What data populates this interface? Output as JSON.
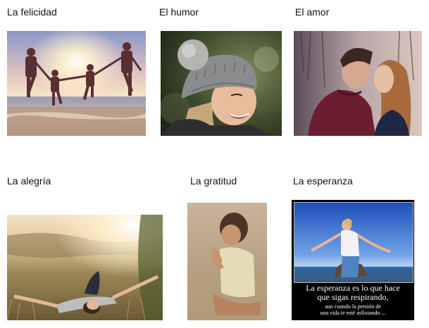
{
  "labels": {
    "felicidad": "La felicidad",
    "humor": "El humor",
    "amor": "El amor",
    "alegria": "La alegría",
    "gratitud": "La gratitud",
    "esperanza": "La esperanza"
  },
  "poster": {
    "line1": "La esperanza es lo que hace",
    "line2": "que sigas respirando,",
    "line3": "aun cuando la presión de",
    "line4": "una vida te esté asfixiando ..."
  }
}
